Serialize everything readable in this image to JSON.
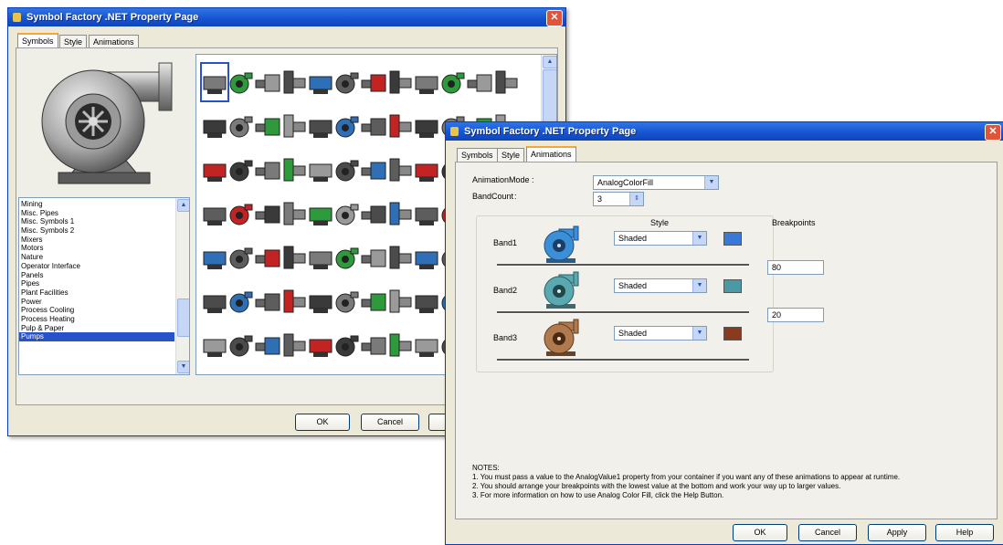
{
  "back_window": {
    "title": "Symbol Factory .NET Property Page",
    "tabs": [
      {
        "label": "Symbols",
        "active": true
      },
      {
        "label": "Style",
        "active": false
      },
      {
        "label": "Animations",
        "active": false
      }
    ],
    "categories": [
      "Mining",
      "Misc. Pipes",
      "Misc. Symbols 1",
      "Misc. Symbols 2",
      "Mixers",
      "Motors",
      "Nature",
      "Operator Interface",
      "Panels",
      "Pipes",
      "Plant Facilities",
      "Power",
      "Process Cooling",
      "Process Heating",
      "Pulp & Paper",
      "Pumps"
    ],
    "selected_category": "Pumps",
    "buttons": {
      "ok": "OK",
      "cancel": "Cancel"
    }
  },
  "front_window": {
    "title": "Symbol Factory .NET Property Page",
    "tabs": [
      {
        "label": "Symbols",
        "active": false
      },
      {
        "label": "Style",
        "active": false
      },
      {
        "label": "Animations",
        "active": true
      }
    ],
    "animation_mode_label": "AnimationMode",
    "animation_mode_value": "AnalogColorFill",
    "band_count_label": "BandCount",
    "band_count_value": "3",
    "style_header": "Style",
    "breakpoints_header": "Breakpoints",
    "bands": [
      {
        "label": "Band1",
        "style": "Shaded",
        "color": "#3a78d8",
        "pump_color": "#3a8fd6"
      },
      {
        "label": "Band2",
        "style": "Shaded",
        "color": "#4a9aa6",
        "pump_color": "#5aa9b0"
      },
      {
        "label": "Band3",
        "style": "Shaded",
        "color": "#8a3a1e",
        "pump_color": "#b07a4e"
      }
    ],
    "breakpoints": [
      "80",
      "20"
    ],
    "notes_title": "NOTES:",
    "notes": [
      "1. You must pass a value to the AnalogValue1 property from your container if you want any of these animations to appear at runtime.",
      "2. You should arrange your breakpoints with the lowest value at the bottom and work your way up to larger values.",
      "3. For more information on how to use Analog Color Fill, click the Help Button."
    ],
    "buttons": {
      "ok": "OK",
      "cancel": "Cancel",
      "apply": "Apply",
      "help": "Help"
    }
  },
  "colors": {
    "title_bar": "#1652d0",
    "dialog_bg": "#ece9d8",
    "selection": "#2a52c8"
  }
}
